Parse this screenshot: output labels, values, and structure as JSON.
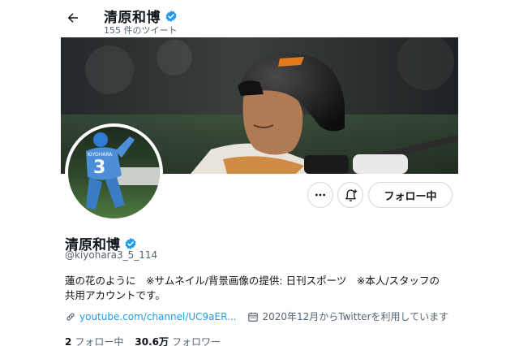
{
  "header": {
    "title": "清原和博",
    "tweet_count": "155 件のツイート",
    "back_icon": "arrow-left-icon"
  },
  "profile": {
    "display_name": "清原和博",
    "handle": "@kiyohara3_5_114",
    "verified_icon": "verified-badge-icon",
    "bio": "蓮の花のように　※サムネイル/背景画像の提供: 日刊スポーツ　※本人/スタッフの\n共用アカウントです。",
    "link": "youtube.com/channel/UC9aER...",
    "joined": "2020年12月からTwitterを利用しています",
    "avatar_jersey_name": "KIYOHARA",
    "avatar_jersey_number": "3"
  },
  "actions": {
    "more_icon": "more-dots-icon",
    "notify_icon": "bell-plus-icon",
    "follow_label": "フォロー中"
  },
  "stats": {
    "following_count": "2",
    "following_label": "フォロー中",
    "followers_count": "30.6万",
    "followers_label": "フォロワー"
  },
  "colors": {
    "accent": "#1d9bf0",
    "text": "#0f1419",
    "secondary": "#536471",
    "border": "#cfd9de"
  }
}
